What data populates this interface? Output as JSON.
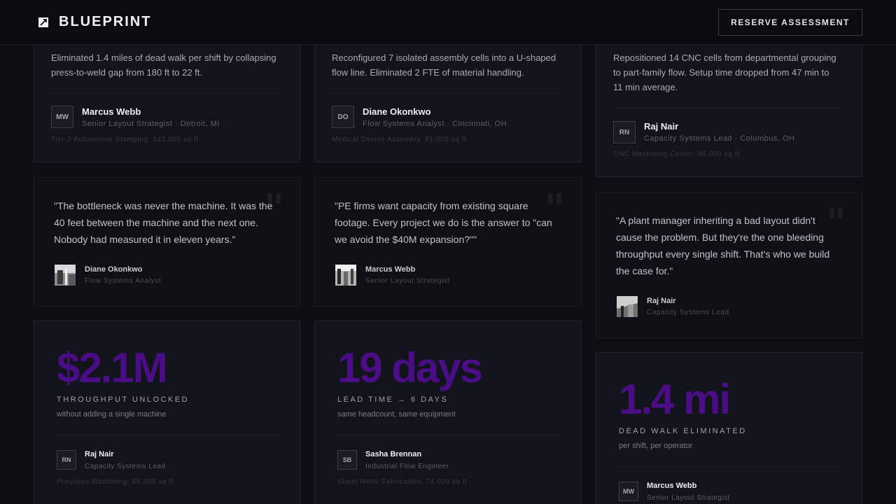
{
  "header": {
    "brand": "BLUEPRINT",
    "cta": "RESERVE ASSESSMENT"
  },
  "case_cards": [
    {
      "body": "Eliminated 1.4 miles of dead walk per shift by collapsing press-to-weld gap from 180 ft to 22 ft.",
      "initials": "MW",
      "name": "Marcus Webb",
      "role": "Senior Layout Strategist · Detroit, MI",
      "footer": "Tier-2 Automotive Stamping, 142,000 sq ft"
    },
    {
      "body": "Reconfigured 7 isolated assembly cells into a U-shaped flow line. Eliminated 2 FTE of material handling.",
      "initials": "DO",
      "name": "Diane Okonkwo",
      "role": "Flow Systems Analyst · Cincinnati, OH",
      "footer": "Medical Device Assembly, 81,000 sq ft"
    },
    {
      "body": "Repositioned 14 CNC cells from departmental grouping to part-family flow. Setup time dropped from 47 min to 11 min average.",
      "initials": "RN",
      "name": "Raj Nair",
      "role": "Capacity Systems Lead · Columbus, OH",
      "footer": "CNC Machining Center, 96,000 sq ft"
    }
  ],
  "quotes": [
    {
      "text": "\"The bottleneck was never the machine. It was the 40 feet between the machine and the next one. Nobody had measured it in eleven years.\"",
      "name": "Diane Okonkwo",
      "role": "Flow Systems Analyst"
    },
    {
      "text": "\"PE firms want capacity from existing square footage. Every project we do is the answer to \"can we avoid the $40M expansion?\"\"",
      "name": "Marcus Webb",
      "role": "Senior Layout Strategist"
    },
    {
      "text": "\"A plant manager inheriting a bad layout didn't cause the problem. But they're the one bleeding throughput every single shift. That's who we build the case for.\"",
      "name": "Raj Nair",
      "role": "Capacity Systems Lead"
    }
  ],
  "stats": [
    {
      "value": "$2.1M",
      "label": "THROUGHPUT UNLOCKED",
      "sub": "without adding a single machine",
      "initials": "RN",
      "name": "Raj Nair",
      "role": "Capacity Systems Lead",
      "footer": "Precision Machining, 88,000 sq ft"
    },
    {
      "value": "19 days",
      "label": "LEAD TIME → 6 DAYS",
      "sub": "same headcount, same equipment",
      "initials": "SB",
      "name": "Sasha Brennan",
      "role": "Industrial Flow Engineer",
      "footer": "Sheet Metal Fabrication, 74,000 sq ft"
    },
    {
      "value": "1.4 mi",
      "label": "DEAD WALK ELIMINATED",
      "sub": "per shift, per operator",
      "initials": "MW",
      "name": "Marcus Webb",
      "role": "Senior Layout Strategist",
      "footer": ""
    }
  ],
  "colors": {
    "accent": "#4b0d85",
    "background": "#0e0f14",
    "card": "#12141c"
  },
  "icons": {
    "brand": "pen-nib-icon",
    "quote": "quote-mark-icon"
  }
}
